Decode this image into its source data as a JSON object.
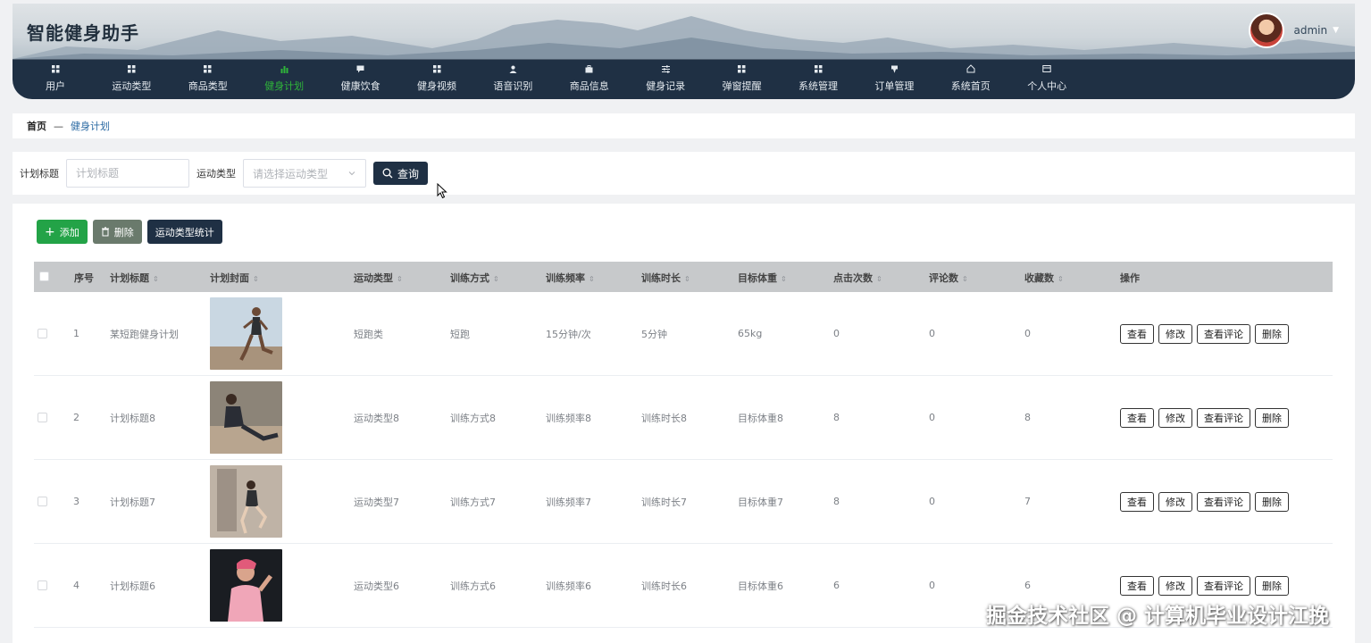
{
  "header": {
    "title": "智能健身助手",
    "user": {
      "name": "admin"
    }
  },
  "nav": [
    {
      "label": "用户",
      "icon": "grid-icon"
    },
    {
      "label": "运动类型",
      "icon": "grid-icon"
    },
    {
      "label": "商品类型",
      "icon": "grid-icon"
    },
    {
      "label": "健身计划",
      "icon": "bar-chart-icon",
      "active": true
    },
    {
      "label": "健康饮食",
      "icon": "chat-icon"
    },
    {
      "label": "健身视频",
      "icon": "grid-icon"
    },
    {
      "label": "语音识别",
      "icon": "user-icon"
    },
    {
      "label": "商品信息",
      "icon": "briefcase-icon"
    },
    {
      "label": "健身记录",
      "icon": "sliders-icon"
    },
    {
      "label": "弹窗提醒",
      "icon": "grid-icon"
    },
    {
      "label": "系统管理",
      "icon": "grid-icon"
    },
    {
      "label": "订单管理",
      "icon": "pin-icon"
    },
    {
      "label": "系统首页",
      "icon": "home-icon"
    },
    {
      "label": "个人中心",
      "icon": "card-icon"
    }
  ],
  "breadcrumb": {
    "home": "首页",
    "separator": "—",
    "current": "健身计划"
  },
  "search": {
    "title_label": "计划标题",
    "title_placeholder": "计划标题",
    "type_label": "运动类型",
    "type_placeholder": "请选择运动类型",
    "query_button": "查询"
  },
  "toolbar": {
    "add": "添加",
    "delete": "删除",
    "stats": "运动类型统计"
  },
  "table": {
    "columns": [
      "序号",
      "计划标题",
      "计划封面",
      "运动类型",
      "训练方式",
      "训练频率",
      "训练时长",
      "目标体重",
      "点击次数",
      "评论数",
      "收藏数",
      "操作"
    ],
    "rows": [
      {
        "no": "1",
        "title": "某短跑健身计划",
        "type": "短跑类",
        "method": "短跑",
        "freq": "15分钟/次",
        "duration": "5分钟",
        "weight": "65kg",
        "clicks": "0",
        "comments": "0",
        "favs": "0"
      },
      {
        "no": "2",
        "title": "计划标题8",
        "type": "运动类型8",
        "method": "训练方式8",
        "freq": "训练频率8",
        "duration": "训练时长8",
        "weight": "目标体重8",
        "clicks": "8",
        "comments": "0",
        "favs": "8"
      },
      {
        "no": "3",
        "title": "计划标题7",
        "type": "运动类型7",
        "method": "训练方式7",
        "freq": "训练频率7",
        "duration": "训练时长7",
        "weight": "目标体重7",
        "clicks": "8",
        "comments": "0",
        "favs": "7"
      },
      {
        "no": "4",
        "title": "计划标题6",
        "type": "运动类型6",
        "method": "训练方式6",
        "freq": "训练频率6",
        "duration": "训练时长6",
        "weight": "目标体重6",
        "clicks": "6",
        "comments": "0",
        "favs": "6"
      }
    ],
    "actions": [
      "查看",
      "修改",
      "查看评论",
      "删除"
    ]
  },
  "watermark": "掘金技术社区 @ 计算机毕业设计江挽",
  "colors": {
    "header_dark": "#1f3044",
    "active_green": "#2fb43a",
    "add_green": "#23a347",
    "link_blue": "#2b6aa3"
  }
}
